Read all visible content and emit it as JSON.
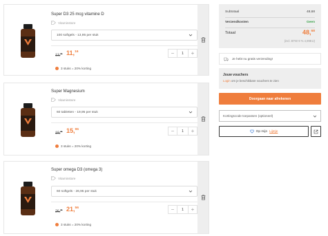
{
  "colors": {
    "accent": "#ef7d3c",
    "free": "#3aa34a",
    "panel": "#eeeeee"
  },
  "products": [
    {
      "name": "Super D3 25 mcg vitamine D",
      "brand": "Vitaminstore",
      "variant": "100 softgels - 13,95 per stuk",
      "old_price_int": "13,",
      "old_price_dec": "95",
      "new_price_int": "11,",
      "new_price_dec": "16",
      "qty": "1",
      "promo": "3 stuks = 20% korting",
      "label_on_bottle": "SUPER D3"
    },
    {
      "name": "Super Magnesium",
      "brand": "Vitaminstore",
      "variant": "60 tabletten - 19,95 per stuk",
      "old_price_int": "19,",
      "old_price_dec": "95",
      "new_price_int": "15,",
      "new_price_dec": "96",
      "qty": "1",
      "promo": "3 stuks = 20% korting",
      "label_on_bottle": "MAGNESIUM"
    },
    {
      "name": "Super omega D3 (omega 3)",
      "brand": "Vitaminstore",
      "variant": "60 softgels - 26,95 per stuk",
      "old_price_int": "26,",
      "old_price_dec": "95",
      "new_price_int": "21,",
      "new_price_dec": "56",
      "qty": "1",
      "promo": "3 stuks = 20% korting",
      "label_on_bottle": "OMEGA D3"
    }
  ],
  "icons": {
    "trash": "trash-icon",
    "tag": "tag-icon",
    "chevron": "chevron-down-icon",
    "minus": "minus-icon",
    "plus": "plus-icon",
    "truck": "truck-icon",
    "heart": "heart-icon",
    "share": "share-icon"
  },
  "summary": {
    "subtotal_label": "Subtotaal",
    "subtotal_value": "48,68",
    "shipping_label": "Verzendkosten",
    "shipping_value": "Geen",
    "total_label": "Totaal",
    "total_int": "48,",
    "total_dec": "68",
    "vat_note": "(incl. BTW 9 % 4,99EU)"
  },
  "shipping_notice": "Je hebt nu gratis verzending!",
  "vouchers": {
    "title": "Jouw vouchers",
    "login_link": "Login",
    "text": " om je beschikbare vouchers te zien"
  },
  "checkout_label": "Doorgaan naar afrekenen",
  "coupon_placeholder": "Kortingscode toepassen (optioneel)",
  "wishlist": {
    "prefix": "Op mijn ",
    "link": "Lijstje"
  }
}
